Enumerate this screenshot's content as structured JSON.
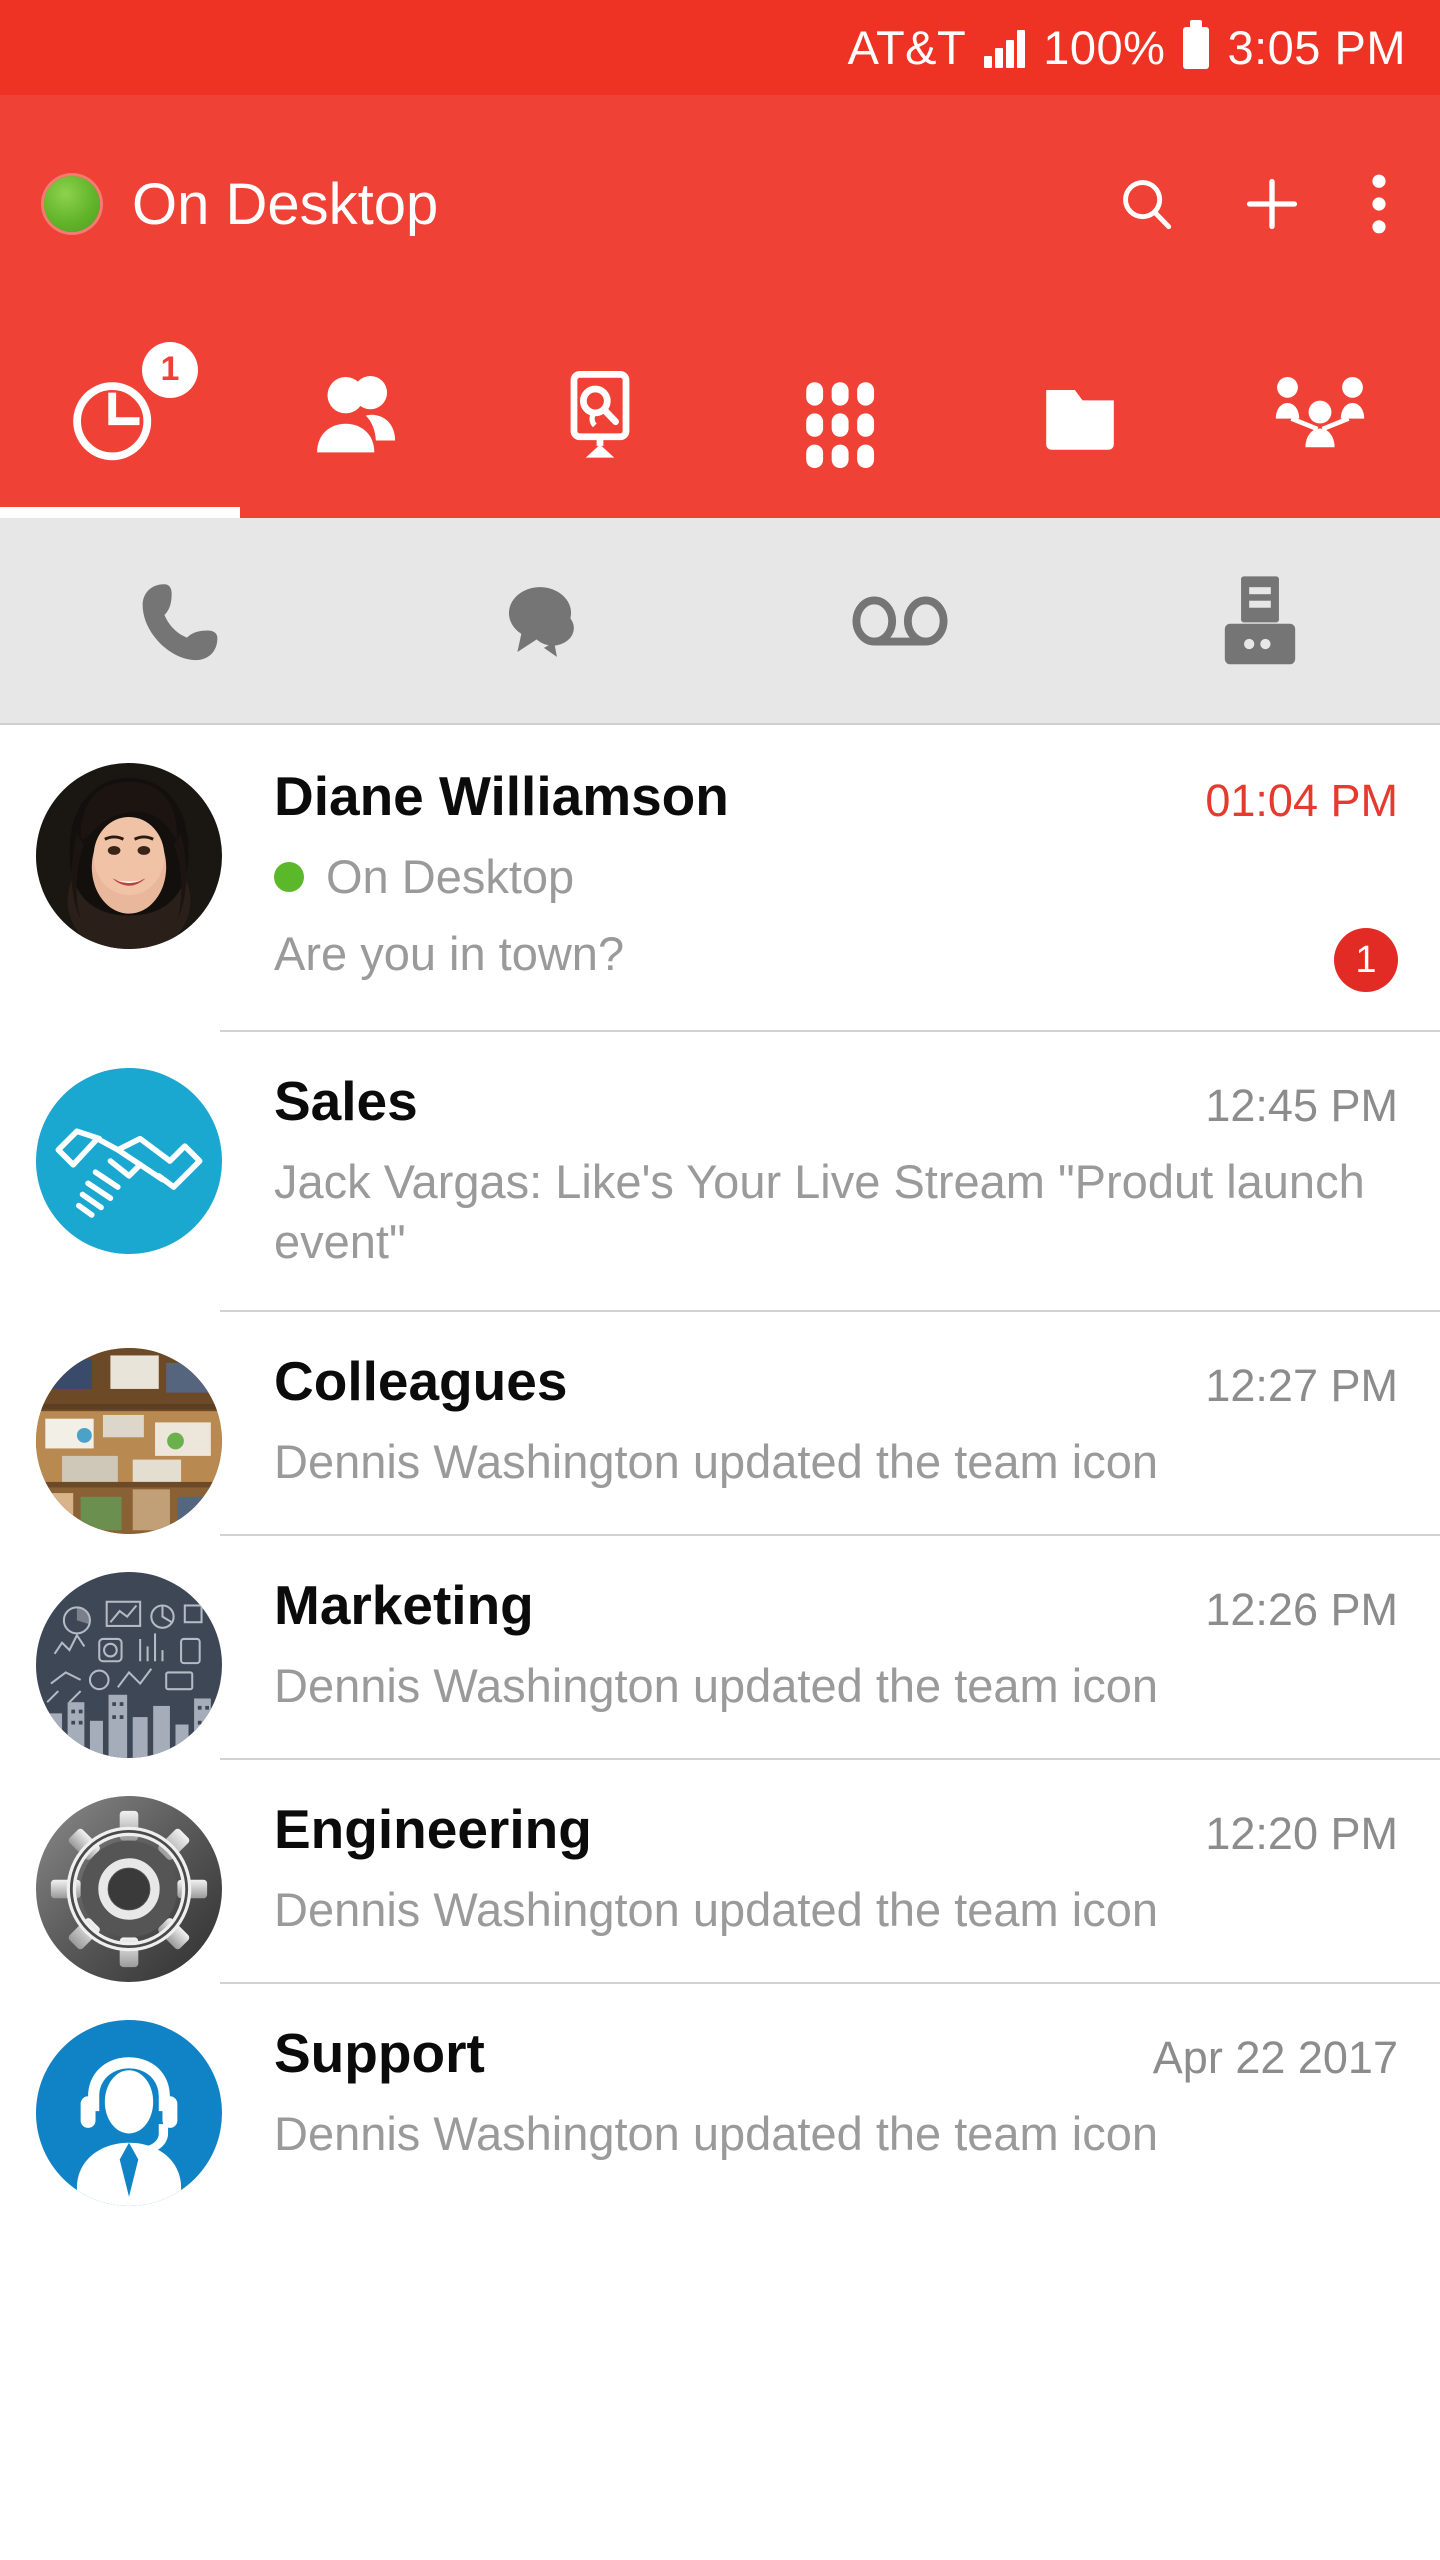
{
  "status_bar": {
    "carrier": "AT&T",
    "battery_percent": "100%",
    "clock": "3:05 PM",
    "signal_icon": "signal-bars-icon",
    "battery_icon": "battery-full-icon"
  },
  "app_bar": {
    "presence_indicator": "presence-online-dot",
    "title": "On Desktop",
    "actions": [
      {
        "name": "search-icon",
        "label": "Search"
      },
      {
        "name": "add-icon",
        "label": "Add"
      },
      {
        "name": "overflow-menu-icon",
        "label": "More options"
      }
    ]
  },
  "primary_tabs": {
    "active_index": 0,
    "items": [
      {
        "name": "tab-recents",
        "icon": "clock-history-icon",
        "label": "Recents",
        "badge": "1"
      },
      {
        "name": "tab-contacts",
        "icon": "people-icon",
        "label": "Contacts",
        "badge": ""
      },
      {
        "name": "tab-presence",
        "icon": "monitor-search-icon",
        "label": "Presence",
        "badge": ""
      },
      {
        "name": "tab-keypad",
        "icon": "dialpad-grid-icon",
        "label": "Keypad",
        "badge": ""
      },
      {
        "name": "tab-files",
        "icon": "folder-icon",
        "label": "Files",
        "badge": ""
      },
      {
        "name": "tab-teams",
        "icon": "team-conference-icon",
        "label": "Teams",
        "badge": ""
      }
    ]
  },
  "filter_tabs": {
    "items": [
      {
        "name": "filter-calls",
        "icon": "phone-handset-icon",
        "label": "Calls"
      },
      {
        "name": "filter-messages",
        "icon": "chat-bubbles-icon",
        "label": "Messages"
      },
      {
        "name": "filter-voicemail",
        "icon": "voicemail-icon",
        "label": "Voicemail"
      },
      {
        "name": "filter-fax",
        "icon": "fax-machine-icon",
        "label": "Fax"
      }
    ]
  },
  "conversations": [
    {
      "name": "Diane Williamson",
      "avatar": "photo-woman-portrait",
      "avatar_kind": "photo-person",
      "time": "01:04 PM",
      "time_accent": true,
      "presence": "On Desktop",
      "has_presence": true,
      "message": "Are you in town?",
      "unread": "1"
    },
    {
      "name": "Sales",
      "avatar": "handshake-icon",
      "avatar_kind": "handshake",
      "time": "12:45 PM",
      "time_accent": false,
      "presence": "",
      "has_presence": false,
      "message": "Jack Vargas: Like's Your Live Stream \"Produt launch event\"",
      "unread": ""
    },
    {
      "name": "Colleagues",
      "avatar": "photo-office-desk",
      "avatar_kind": "photo-desk",
      "time": "12:27 PM",
      "time_accent": false,
      "presence": "",
      "has_presence": false,
      "message": "Dennis Washington updated the team icon",
      "unread": ""
    },
    {
      "name": "Marketing",
      "avatar": "chalkboard-infographic-icon",
      "avatar_kind": "chalkboard",
      "time": "12:26 PM",
      "time_accent": false,
      "presence": "",
      "has_presence": false,
      "message": "Dennis Washington updated the team icon",
      "unread": ""
    },
    {
      "name": "Engineering",
      "avatar": "metal-gear-icon",
      "avatar_kind": "gear",
      "time": "12:20 PM",
      "time_accent": false,
      "presence": "",
      "has_presence": false,
      "message": "Dennis Washington updated the team icon",
      "unread": ""
    },
    {
      "name": "Support",
      "avatar": "headset-agent-icon",
      "avatar_kind": "headset",
      "time": "Apr 22 2017",
      "time_accent": false,
      "presence": "",
      "has_presence": false,
      "message": "Dennis Washington updated the team icon",
      "unread": ""
    }
  ],
  "colors": {
    "status_bar_red": "#ee3224",
    "app_bar_red": "#ef4136",
    "badge_red": "#e32b26",
    "accent_time_red": "#e53a2e",
    "filter_bar_gray": "#e7e7e7",
    "icon_gray": "#757575",
    "secondary_text_gray": "#9a9a9a",
    "presence_green": "#5cb82b",
    "sales_cyan": "#1aa7d0",
    "support_blue": "#1083c6"
  }
}
